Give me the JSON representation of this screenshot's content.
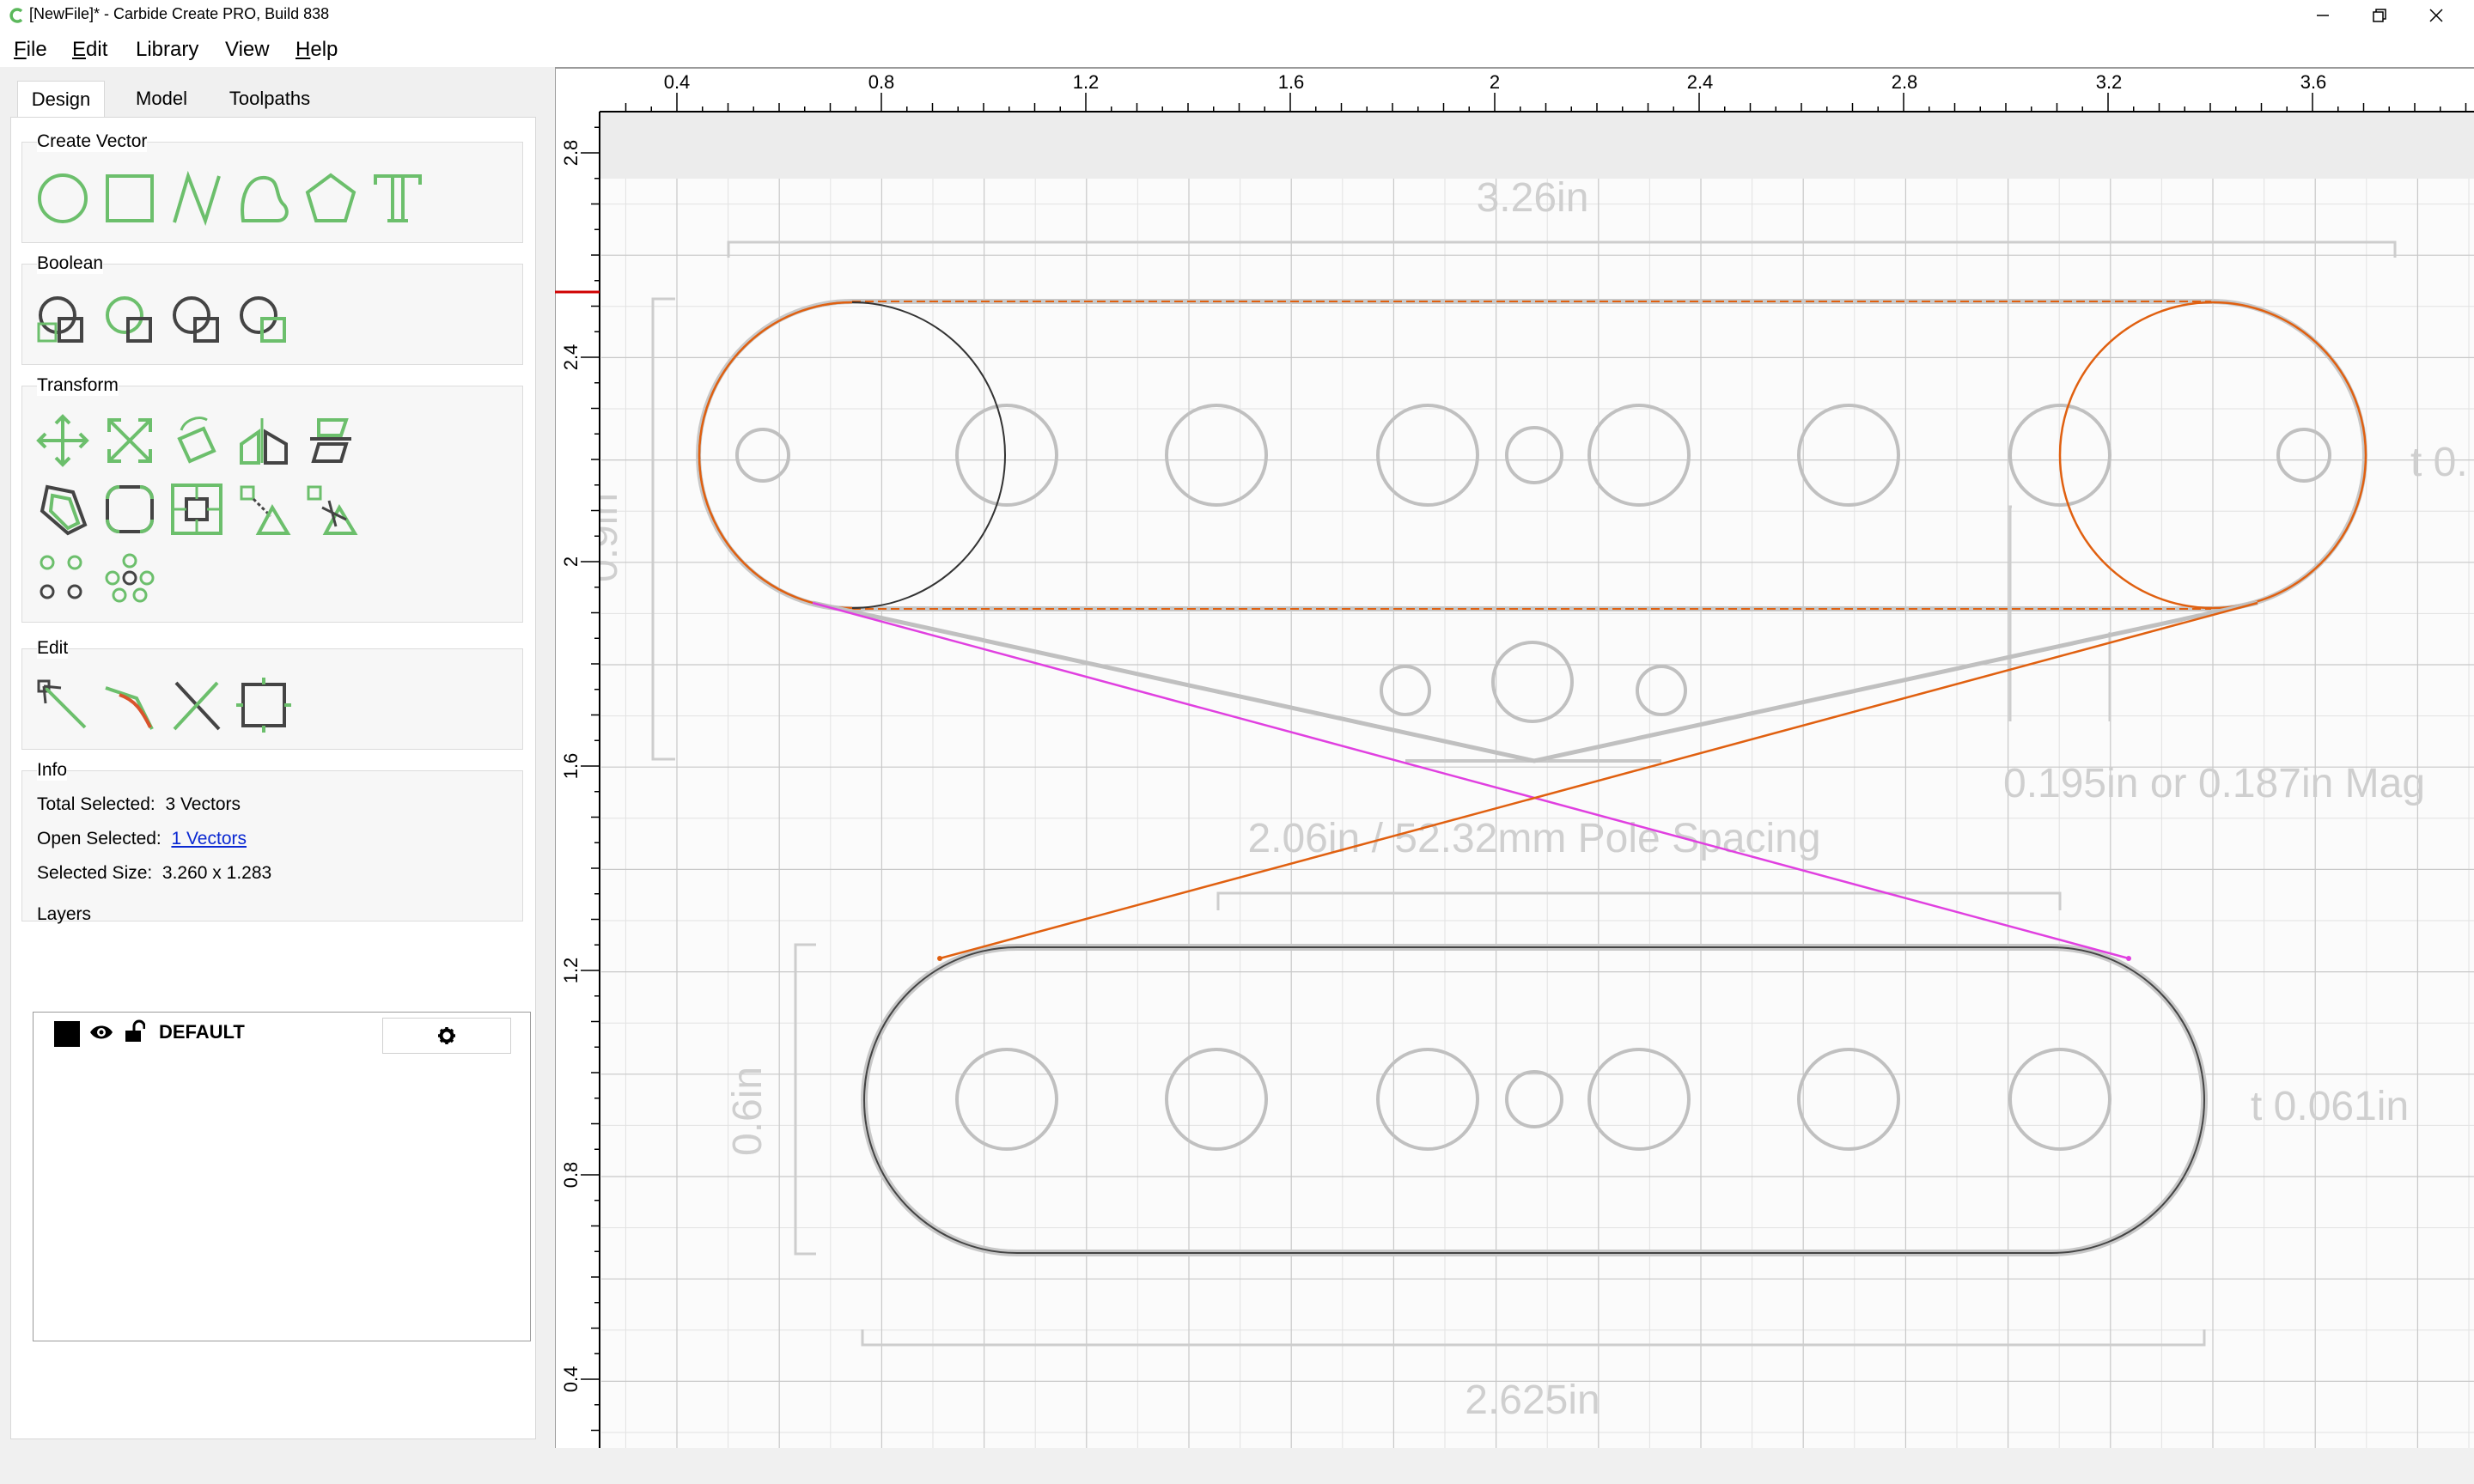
{
  "window": {
    "title": "[NewFile]* - Carbide Create PRO, Build 838",
    "controls": [
      "minimize",
      "restore",
      "close"
    ]
  },
  "menu": {
    "items": [
      {
        "label": "File",
        "underline": "F",
        "rest": "ile"
      },
      {
        "label": "Edit",
        "underline": "E",
        "rest": "dit"
      },
      {
        "label": "Library",
        "underline": "",
        "rest": "Library"
      },
      {
        "label": "View",
        "underline": "",
        "rest": "View"
      },
      {
        "label": "Help",
        "underline": "H",
        "rest": "elp"
      }
    ]
  },
  "tabs": [
    {
      "label": "Design",
      "active": true
    },
    {
      "label": "Model",
      "active": false
    },
    {
      "label": "Toolpaths",
      "active": false
    }
  ],
  "groups": {
    "create_vector": "Create Vector",
    "boolean": "Boolean",
    "transform": "Transform",
    "edit": "Edit",
    "info": "Info",
    "layers": "Layers"
  },
  "tools": {
    "create_vector": [
      "circle-tool-icon",
      "rectangle-tool-icon",
      "polyline-tool-icon",
      "curve-tool-icon",
      "polygon-tool-icon",
      "text-tool-icon"
    ],
    "boolean": [
      "union-icon",
      "subtract-icon",
      "intersect-icon",
      "weld-icon"
    ],
    "transform": [
      "move-icon",
      "scale-icon",
      "rotate-icon",
      "mirror-icon",
      "align-icon",
      "offset-icon",
      "fillet-icon",
      "center-icon",
      "distort-icon",
      "trim-icon",
      "grid-array-icon",
      "circular-array-icon"
    ],
    "edit": [
      "node-edit-icon",
      "smooth-icon",
      "cut-icon",
      "box-icon"
    ]
  },
  "info": {
    "total_selected_label": "Total Selected:",
    "total_selected_value": "3 Vectors",
    "open_selected_label": "Open Selected:",
    "open_selected_value": "1 Vectors",
    "selected_size_label": "Selected Size:",
    "selected_size_value": "3.260 x 1.283"
  },
  "layers": [
    {
      "name": "DEFAULT",
      "color": "#000000",
      "visible": true,
      "locked": false
    }
  ],
  "rulers": {
    "top": [
      "0.4",
      "0.8",
      "1.2",
      "1.6",
      "2",
      "2.4",
      "2.8",
      "3.2",
      "3.6"
    ],
    "left": [
      "2.8",
      "2.4",
      "2",
      "1.6",
      "1.2",
      "0.8",
      "0.4"
    ]
  },
  "drawing_labels": {
    "top_width": "3.26in",
    "right_partial": "t 0.",
    "left_vertical": "0.9in",
    "magnet": "0.195in or 0.187in Mag",
    "pole_spacing": "2.06in / 52.32mm Pole Spacing",
    "left_vertical_bottom": "0.6in",
    "thickness": "t 0.061in",
    "bottom_width": "2.625in"
  },
  "colors": {
    "accent_green": "#5cb85c",
    "selection_orange": "#e06010",
    "guide_magenta": "#e040e0",
    "ruler_marker": "#d00000",
    "link_blue": "#0a28d2"
  }
}
